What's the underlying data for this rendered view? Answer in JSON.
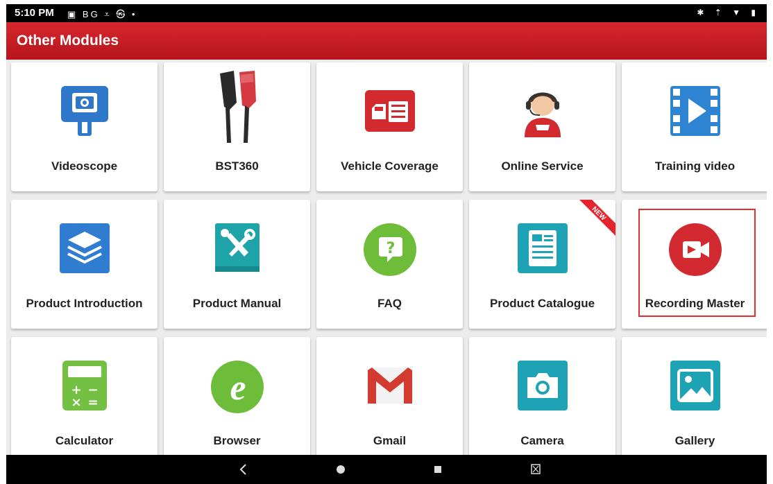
{
  "status": {
    "time": "5:10 PM",
    "left_icons": "▣ BG ⩡ ㉿ •",
    "right_icons": "✱ ⇡ ▼ ▮"
  },
  "app": {
    "title": "Other Modules"
  },
  "tiles": [
    {
      "label": "Videoscope",
      "icon": "videoscope-icon"
    },
    {
      "label": "BST360",
      "icon": "battery-clamps-icon"
    },
    {
      "label": "Vehicle Coverage",
      "icon": "vehicle-coverage-icon"
    },
    {
      "label": "Online Service",
      "icon": "support-agent-icon"
    },
    {
      "label": "Training video",
      "icon": "video-play-icon"
    },
    {
      "label": "Product Introduction",
      "icon": "layers-icon"
    },
    {
      "label": "Product Manual",
      "icon": "manual-tools-icon"
    },
    {
      "label": "FAQ",
      "icon": "question-bubble-icon"
    },
    {
      "label": "Product Catalogue",
      "icon": "catalogue-icon",
      "badge": "NEW"
    },
    {
      "label": "Recording Master",
      "icon": "record-camera-icon",
      "selected": true
    },
    {
      "label": "Calculator",
      "icon": "calculator-icon"
    },
    {
      "label": "Browser",
      "icon": "browser-e-icon"
    },
    {
      "label": "Gmail",
      "icon": "gmail-icon"
    },
    {
      "label": "Camera",
      "icon": "camera-icon"
    },
    {
      "label": "Gallery",
      "icon": "gallery-icon"
    }
  ],
  "colors": {
    "accent": "#c81d24",
    "highlight": "#e52d2d",
    "tile_bg": "#ffffff",
    "page_bg": "#ececec"
  },
  "navbar": {
    "buttons": [
      "back-icon",
      "home-icon",
      "recents-icon",
      "screenshot-icon"
    ]
  }
}
